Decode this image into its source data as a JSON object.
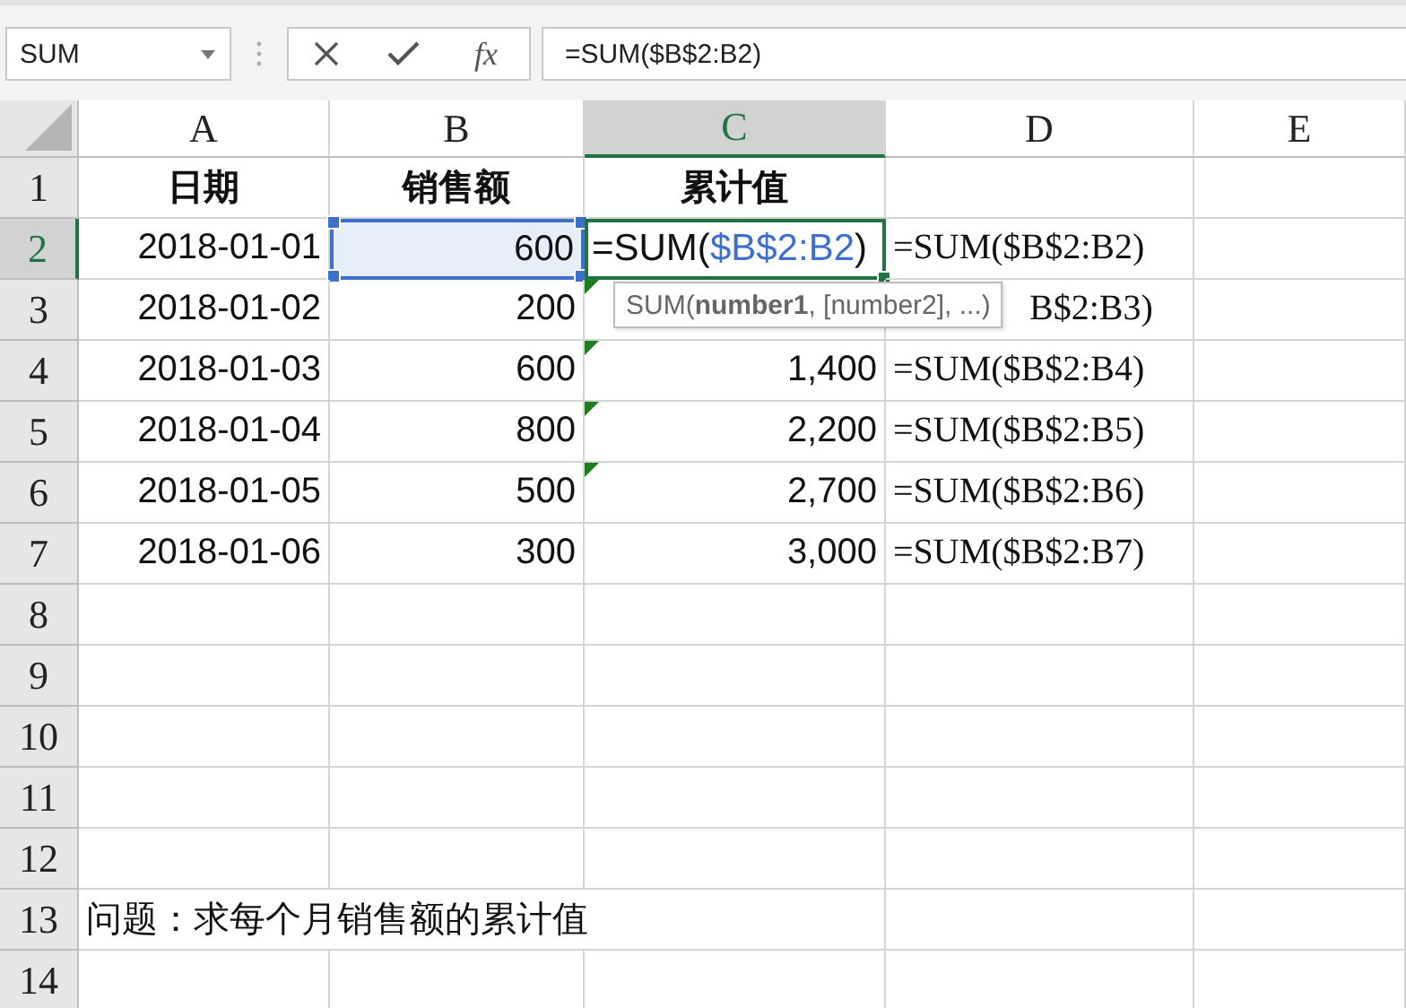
{
  "name_box": "SUM",
  "function_button": "fx",
  "formula_bar": "=SUM($B$2:B2)",
  "columns": [
    {
      "label": "A",
      "selected": false
    },
    {
      "label": "B",
      "selected": false
    },
    {
      "label": "C",
      "selected": true
    },
    {
      "label": "D",
      "selected": false
    },
    {
      "label": "E",
      "selected": false
    }
  ],
  "rows": [
    {
      "label": "1",
      "selected": false,
      "cells": [
        {
          "kind": "header",
          "text": "日期"
        },
        {
          "kind": "header",
          "text": "销售额"
        },
        {
          "kind": "header",
          "text": "累计值"
        },
        {
          "kind": "empty"
        },
        {
          "kind": "empty"
        }
      ]
    },
    {
      "label": "2",
      "selected": true,
      "cells": [
        {
          "kind": "number",
          "text": "2018-01-01"
        },
        {
          "kind": "number",
          "text": "600",
          "referenced": true
        },
        {
          "kind": "edit",
          "parts": [
            {
              "kind": "plain",
              "text": "=SUM("
            },
            {
              "kind": "ref",
              "text": "$B$2:B2"
            },
            {
              "kind": "plain",
              "text": ")"
            }
          ]
        },
        {
          "kind": "formula",
          "text": "=SUM($B$2:B2)"
        },
        {
          "kind": "empty"
        }
      ]
    },
    {
      "label": "3",
      "selected": false,
      "cells": [
        {
          "kind": "number",
          "text": "2018-01-02"
        },
        {
          "kind": "number",
          "text": "200"
        },
        {
          "kind": "empty",
          "flag": true
        },
        {
          "kind": "formula_tail",
          "text": "B$2:B3)"
        },
        {
          "kind": "empty"
        }
      ]
    },
    {
      "label": "4",
      "selected": false,
      "cells": [
        {
          "kind": "number",
          "text": "2018-01-03"
        },
        {
          "kind": "number",
          "text": "600"
        },
        {
          "kind": "number",
          "text": "1,400",
          "flag": true
        },
        {
          "kind": "formula",
          "text": "=SUM($B$2:B4)"
        },
        {
          "kind": "empty"
        }
      ]
    },
    {
      "label": "5",
      "selected": false,
      "cells": [
        {
          "kind": "number",
          "text": "2018-01-04"
        },
        {
          "kind": "number",
          "text": "800"
        },
        {
          "kind": "number",
          "text": "2,200",
          "flag": true
        },
        {
          "kind": "formula",
          "text": "=SUM($B$2:B5)"
        },
        {
          "kind": "empty"
        }
      ]
    },
    {
      "label": "6",
      "selected": false,
      "cells": [
        {
          "kind": "number",
          "text": "2018-01-05"
        },
        {
          "kind": "number",
          "text": "500"
        },
        {
          "kind": "number",
          "text": "2,700",
          "flag": true
        },
        {
          "kind": "formula",
          "text": "=SUM($B$2:B6)"
        },
        {
          "kind": "empty"
        }
      ]
    },
    {
      "label": "7",
      "selected": false,
      "cells": [
        {
          "kind": "number",
          "text": "2018-01-06"
        },
        {
          "kind": "number",
          "text": "300"
        },
        {
          "kind": "number",
          "text": "3,000"
        },
        {
          "kind": "formula",
          "text": "=SUM($B$2:B7)"
        },
        {
          "kind": "empty"
        }
      ]
    },
    {
      "label": "8",
      "selected": false,
      "cells": [
        {
          "kind": "empty"
        },
        {
          "kind": "empty"
        },
        {
          "kind": "empty"
        },
        {
          "kind": "empty"
        },
        {
          "kind": "empty"
        }
      ]
    },
    {
      "label": "9",
      "selected": false,
      "cells": [
        {
          "kind": "empty"
        },
        {
          "kind": "empty"
        },
        {
          "kind": "empty"
        },
        {
          "kind": "empty"
        },
        {
          "kind": "empty"
        }
      ]
    },
    {
      "label": "10",
      "selected": false,
      "cells": [
        {
          "kind": "empty"
        },
        {
          "kind": "empty"
        },
        {
          "kind": "empty"
        },
        {
          "kind": "empty"
        },
        {
          "kind": "empty"
        }
      ]
    },
    {
      "label": "11",
      "selected": false,
      "cells": [
        {
          "kind": "empty"
        },
        {
          "kind": "empty"
        },
        {
          "kind": "empty"
        },
        {
          "kind": "empty"
        },
        {
          "kind": "empty"
        }
      ]
    },
    {
      "label": "12",
      "selected": false,
      "cells": [
        {
          "kind": "empty"
        },
        {
          "kind": "empty"
        },
        {
          "kind": "empty"
        },
        {
          "kind": "empty"
        },
        {
          "kind": "empty"
        }
      ]
    },
    {
      "label": "13",
      "selected": false,
      "cells": [
        {
          "kind": "note",
          "text": "问题：求每个月销售额的累计值"
        },
        {
          "kind": "empty"
        },
        {
          "kind": "empty"
        }
      ]
    },
    {
      "label": "14",
      "selected": false,
      "cells": [
        {
          "kind": "empty"
        },
        {
          "kind": "empty"
        },
        {
          "kind": "empty"
        },
        {
          "kind": "empty"
        },
        {
          "kind": "empty"
        }
      ]
    }
  ],
  "tooltip": "SUM(**number1**, [number2], ...)"
}
